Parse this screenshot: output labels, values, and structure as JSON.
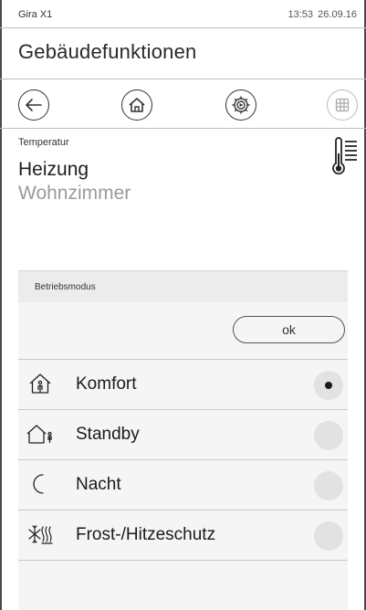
{
  "status": {
    "device": "Gira X1",
    "time": "13:53",
    "date": "26.09.16"
  },
  "page_title": "Gebäudefunktionen",
  "nav": {
    "back_icon": "arrow-left-icon",
    "home_icon": "home-icon",
    "settings_icon": "gear-icon",
    "grid_icon": "grid-icon"
  },
  "function": {
    "category": "Temperatur",
    "name": "Heizung",
    "room": "Wohnzimmer",
    "icon": "thermometer-icon"
  },
  "panel": {
    "title": "Betriebsmodus",
    "ok_label": "ok",
    "options": [
      {
        "label": "Komfort",
        "icon": "house-person-icon",
        "selected": true
      },
      {
        "label": "Standby",
        "icon": "house-person-outside-icon",
        "selected": false
      },
      {
        "label": "Nacht",
        "icon": "moon-icon",
        "selected": false
      },
      {
        "label": "Frost-/Hitzeschutz",
        "icon": "frost-heat-icon",
        "selected": false
      }
    ]
  },
  "colors": {
    "accent": "#1a1a1a",
    "muted_text": "#9a9a9a",
    "panel_bg": "#f5f5f5",
    "header_bg": "#ececec",
    "radio_bg": "#e2e2e2"
  }
}
